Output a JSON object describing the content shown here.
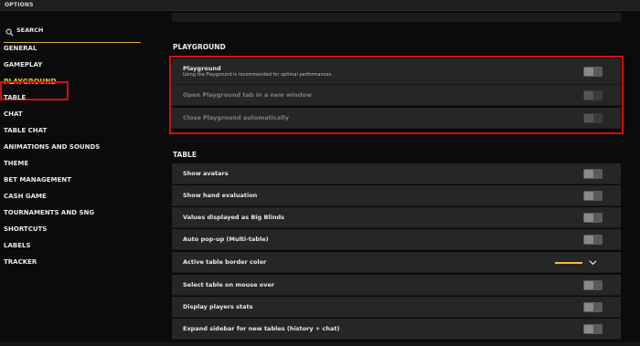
{
  "window": {
    "title": "OPTIONS"
  },
  "search": {
    "label": "SEARCH"
  },
  "colors": {
    "accent": "#f2c230",
    "highlight_box": "#d01010"
  },
  "sidebar": {
    "items": [
      {
        "label": "GENERAL"
      },
      {
        "label": "GAMEPLAY"
      },
      {
        "label": "PLAYGROUND"
      },
      {
        "label": "TABLE"
      },
      {
        "label": "CHAT"
      },
      {
        "label": "TABLE CHAT"
      },
      {
        "label": "ANIMATIONS AND SOUNDS"
      },
      {
        "label": "THEME"
      },
      {
        "label": "BET MANAGEMENT"
      },
      {
        "label": "CASH GAME"
      },
      {
        "label": "TOURNAMENTS AND SNG"
      },
      {
        "label": "SHORTCUTS"
      },
      {
        "label": "LABELS"
      },
      {
        "label": "TRACKER"
      }
    ],
    "active_item": "PLAYGROUND"
  },
  "playground": {
    "title": "PLAYGROUND",
    "rows": [
      {
        "label": "Playground",
        "description": "Using the Playground is recommended for optimal performances.",
        "enabled": false
      },
      {
        "label": "Open Playground tab in a new window",
        "enabled": false,
        "disabled": true
      },
      {
        "label": "Close Playground automatically",
        "enabled": false,
        "disabled": true
      }
    ]
  },
  "table": {
    "title": "TABLE",
    "rows": [
      {
        "label": "Show avatars",
        "enabled": false
      },
      {
        "label": "Show hand evaluation",
        "enabled": false
      },
      {
        "label": "Values displayed as Big Blinds",
        "enabled": false
      },
      {
        "label": "Auto pop-up (Multi-table)",
        "enabled": false
      },
      {
        "label": "Active table border color",
        "color": "#f2c230"
      },
      {
        "label": "Select table on mouse over",
        "enabled": false
      },
      {
        "label": "Display players stats",
        "enabled": false
      },
      {
        "label": "Expand sidebar for new tables (history + chat)",
        "enabled": false
      }
    ]
  }
}
